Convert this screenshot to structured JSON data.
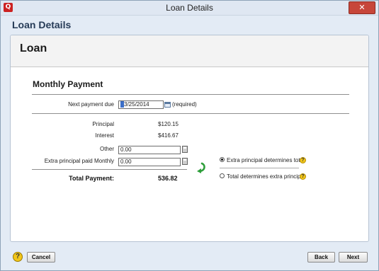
{
  "window": {
    "title": "Loan Details",
    "close_glyph": "✕",
    "app_icon": "app-logo-icon"
  },
  "page": {
    "heading": "Loan Details"
  },
  "panel": {
    "title": "Loan",
    "section_title": "Monthly Payment"
  },
  "form": {
    "next_payment_label": "Next payment due",
    "next_payment_value": "3/25/2014",
    "required_note": "(required)",
    "principal_label": "Principal",
    "principal_value": "$120.15",
    "interest_label": "Interest",
    "interest_value": "$416.67",
    "other_label": "Other",
    "other_value": "0.00",
    "extra_label": "Extra principal paid Monthly",
    "extra_value": "0.00",
    "total_label": "Total Payment:",
    "total_value": "536.82"
  },
  "options": {
    "radio1_label": "Extra principal determines total",
    "radio1_selected": true,
    "radio2_label": "Total determines extra principal",
    "radio2_selected": false
  },
  "buttons": {
    "cancel": "Cancel",
    "back": "Back",
    "next": "Next",
    "help_glyph": "?"
  },
  "colors": {
    "help_yellow": "#f2c619",
    "arrow_green": "#2e9e3a",
    "close_red": "#c7463a"
  }
}
